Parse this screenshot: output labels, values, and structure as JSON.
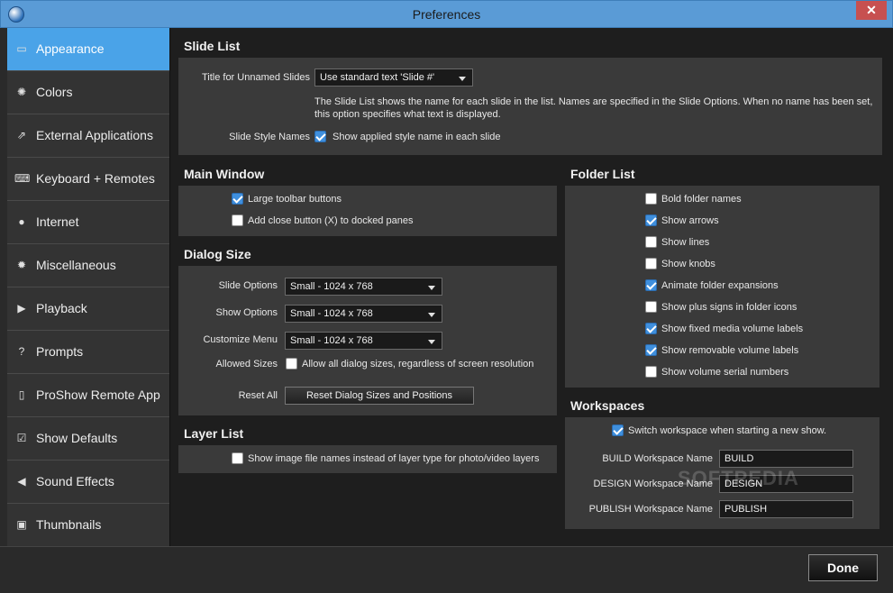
{
  "window": {
    "title": "Preferences",
    "close": "✕"
  },
  "sidebar": {
    "items": [
      {
        "label": "Appearance",
        "icon": "appearance-icon",
        "glyph": "▭"
      },
      {
        "label": "Colors",
        "icon": "colors-icon",
        "glyph": "✺"
      },
      {
        "label": "External Applications",
        "icon": "external-apps-icon",
        "glyph": "⇗"
      },
      {
        "label": "Keyboard + Remotes",
        "icon": "keyboard-icon",
        "glyph": "⌨"
      },
      {
        "label": "Internet",
        "icon": "globe-icon",
        "glyph": "●"
      },
      {
        "label": "Miscellaneous",
        "icon": "gear-icon",
        "glyph": "✹"
      },
      {
        "label": "Playback",
        "icon": "play-icon",
        "glyph": "▶"
      },
      {
        "label": "Prompts",
        "icon": "question-icon",
        "glyph": "?"
      },
      {
        "label": "ProShow Remote App",
        "icon": "remote-icon",
        "glyph": "▯"
      },
      {
        "label": "Show Defaults",
        "icon": "checkbox-icon",
        "glyph": "☑"
      },
      {
        "label": "Sound Effects",
        "icon": "speaker-icon",
        "glyph": "◀"
      },
      {
        "label": "Thumbnails",
        "icon": "thumbnails-icon",
        "glyph": "▣"
      }
    ]
  },
  "slide_list": {
    "title": "Slide List",
    "unnamed_label": "Title for Unnamed Slides",
    "unnamed_value": "Use standard text 'Slide #'",
    "description": "The Slide List shows the name for each slide in the list. Names are specified in the Slide Options. When no name has been set, this option specifies what text is displayed.",
    "style_names_label": "Slide Style Names",
    "style_names_option": "Show applied style name in each slide"
  },
  "main_window": {
    "title": "Main Window",
    "large_toolbar": "Large toolbar buttons",
    "close_button": "Add close button (X) to docked panes"
  },
  "dialog_size": {
    "title": "Dialog Size",
    "slide_options_label": "Slide Options",
    "slide_options_value": "Small - 1024 x 768",
    "show_options_label": "Show Options",
    "show_options_value": "Small - 1024 x 768",
    "customize_menu_label": "Customize Menu",
    "customize_menu_value": "Small - 1024 x 768",
    "allowed_sizes_label": "Allowed Sizes",
    "allowed_sizes_option": "Allow all dialog sizes, regardless of screen resolution",
    "reset_label": "Reset All",
    "reset_button": "Reset Dialog Sizes and Positions"
  },
  "layer_list": {
    "title": "Layer List",
    "option": "Show image file names instead of layer type for photo/video layers"
  },
  "folder_list": {
    "title": "Folder List",
    "options": [
      {
        "label": "Bold folder names",
        "checked": false
      },
      {
        "label": "Show arrows",
        "checked": true
      },
      {
        "label": "Show lines",
        "checked": false
      },
      {
        "label": "Show knobs",
        "checked": false
      },
      {
        "label": "Animate folder expansions",
        "checked": true
      },
      {
        "label": "Show plus signs in folder icons",
        "checked": false
      },
      {
        "label": "Show fixed media volume labels",
        "checked": true
      },
      {
        "label": "Show removable volume labels",
        "checked": true
      },
      {
        "label": "Show volume serial numbers",
        "checked": false
      }
    ]
  },
  "workspaces": {
    "title": "Workspaces",
    "switch_option": "Switch workspace when starting a new show.",
    "build_label": "BUILD Workspace Name",
    "build_value": "BUILD",
    "design_label": "DESIGN Workspace Name",
    "design_value": "DESIGN",
    "publish_label": "PUBLISH Workspace Name",
    "publish_value": "PUBLISH"
  },
  "footer": {
    "done": "Done"
  },
  "watermark": "SOFTPEDIA"
}
